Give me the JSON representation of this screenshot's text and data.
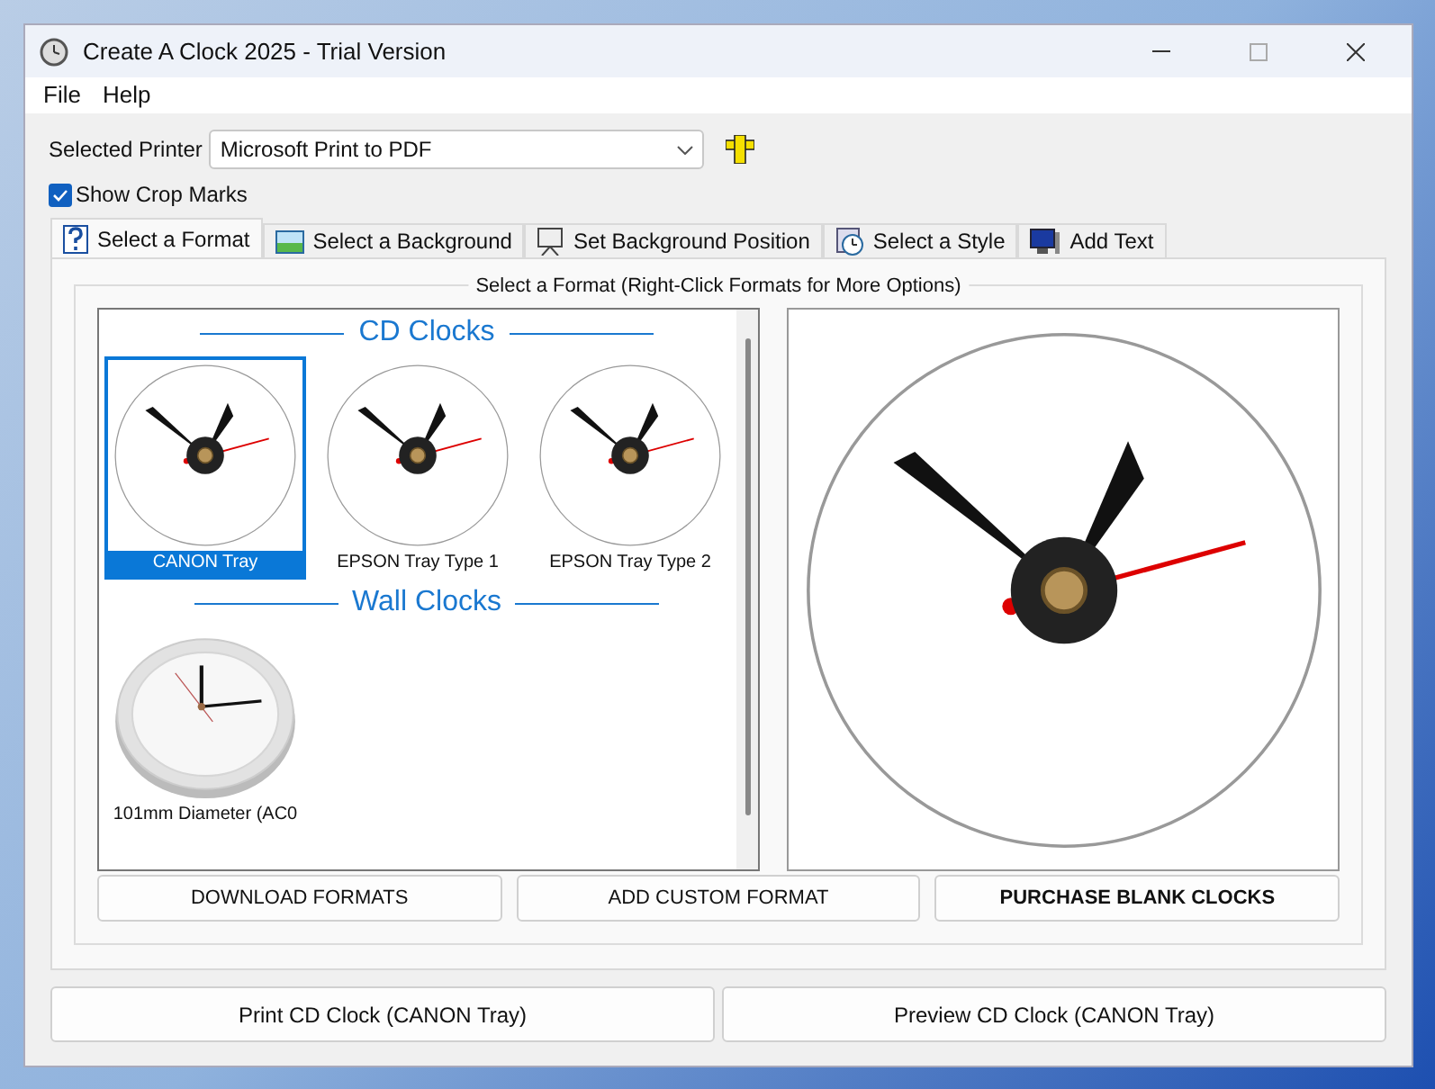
{
  "window": {
    "title": "Create A Clock 2025 - Trial Version"
  },
  "menu": [
    "File",
    "Help"
  ],
  "printer": {
    "label": "Selected Printer",
    "value": "Microsoft Print to PDF"
  },
  "crop_marks": {
    "label": "Show Crop Marks",
    "checked": true
  },
  "tabs": [
    {
      "label": "Select a Format",
      "selected": true
    },
    {
      "label": "Select a Background",
      "selected": false
    },
    {
      "label": "Set Background Position",
      "selected": false
    },
    {
      "label": "Select a Style",
      "selected": false
    },
    {
      "label": "Add Text",
      "selected": false
    }
  ],
  "group": {
    "title": "Select a Format (Right-Click Formats for More Options)"
  },
  "sections": [
    {
      "heading": "CD Clocks",
      "items": [
        {
          "label": "CANON Tray",
          "kind": "cd",
          "selected": true
        },
        {
          "label": "EPSON Tray Type 1",
          "kind": "cd",
          "selected": false
        },
        {
          "label": "EPSON Tray Type 2",
          "kind": "cd",
          "selected": false
        }
      ]
    },
    {
      "heading": "Wall Clocks",
      "items": [
        {
          "label": "101mm Diameter (AC0",
          "kind": "wall",
          "selected": false
        }
      ]
    }
  ],
  "format_buttons": [
    {
      "label": "DOWNLOAD FORMATS",
      "bold": false
    },
    {
      "label": "ADD CUSTOM FORMAT",
      "bold": false
    },
    {
      "label": "PURCHASE BLANK CLOCKS",
      "bold": true
    }
  ],
  "action_buttons": [
    "Print CD Clock (CANON Tray)",
    "Preview CD Clock (CANON Tray)"
  ]
}
